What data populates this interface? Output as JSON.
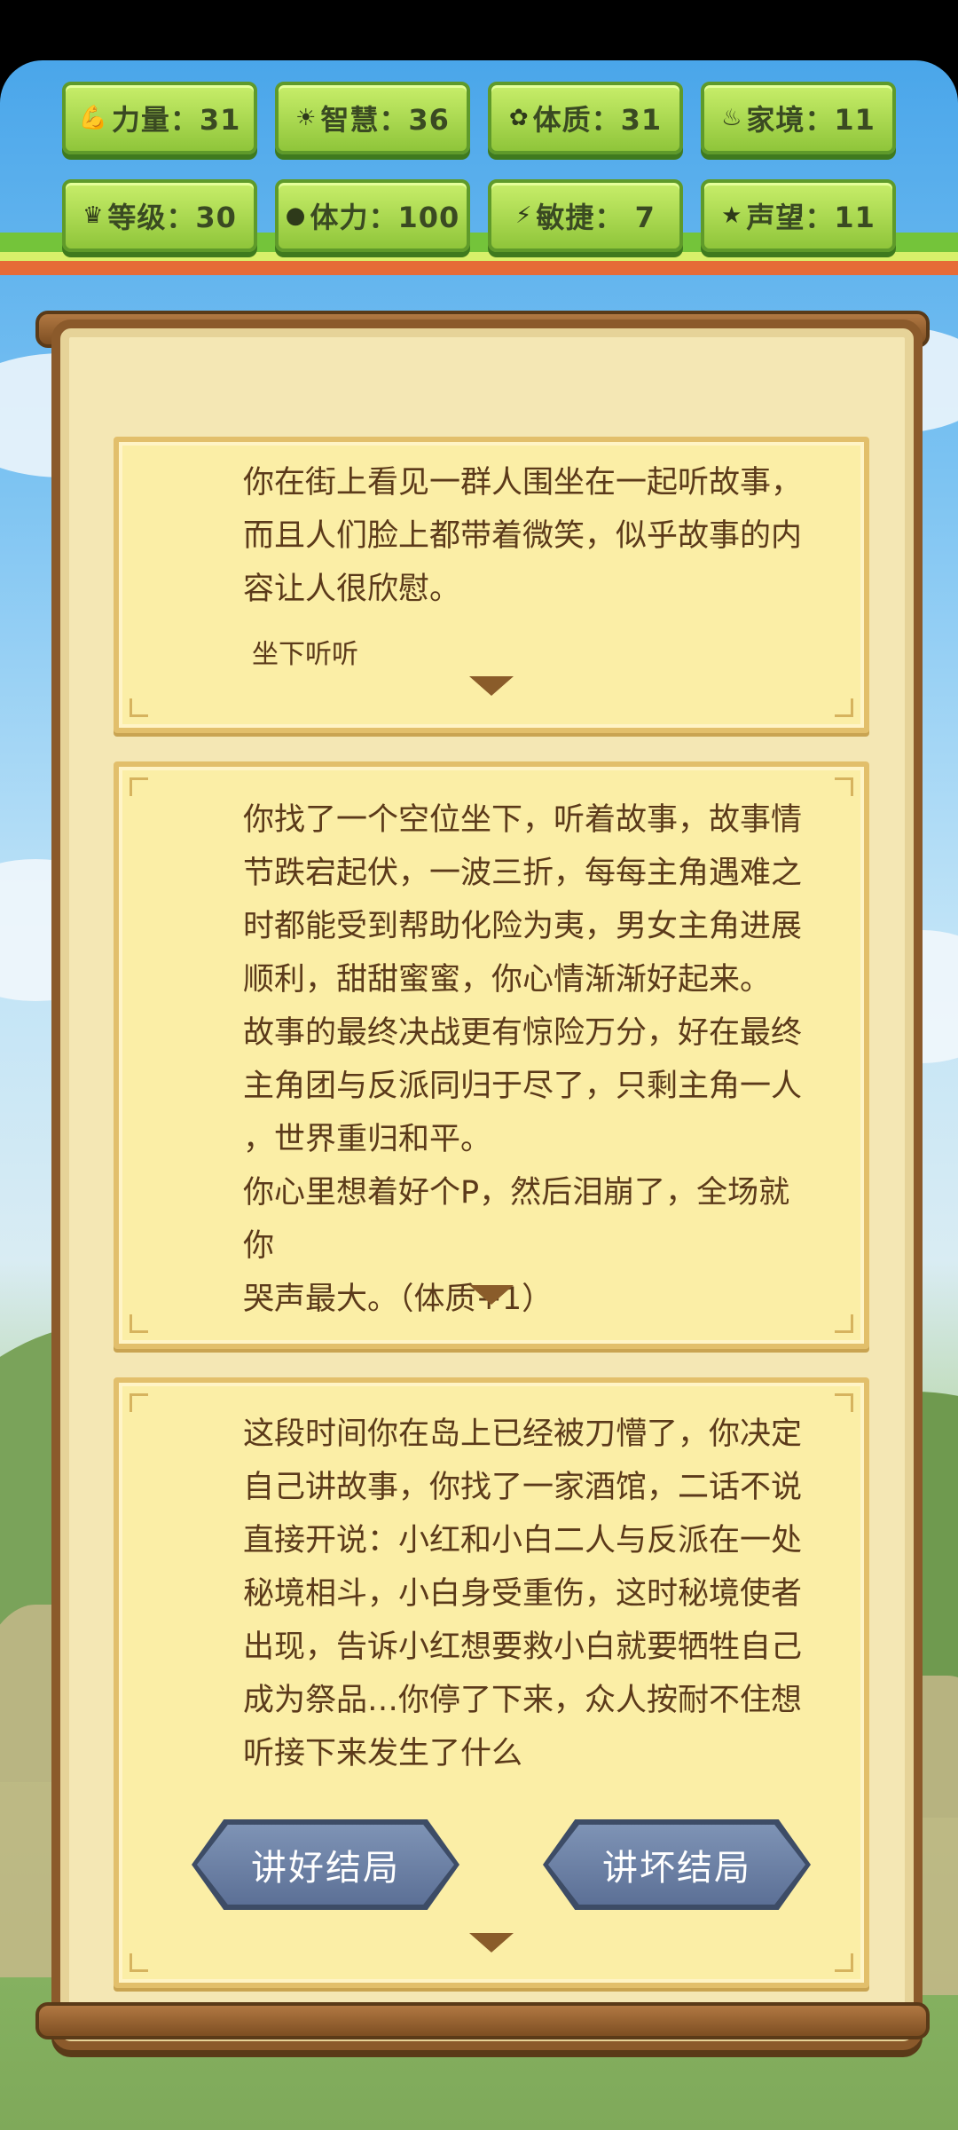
{
  "stats": [
    {
      "icon": "arm-icon",
      "glyph": "💪",
      "label": "力量：31"
    },
    {
      "icon": "sun-icon",
      "glyph": "☀",
      "label": "智慧：36"
    },
    {
      "icon": "constitution-icon",
      "glyph": "✿",
      "label": "体质：31"
    },
    {
      "icon": "family-icon",
      "glyph": "♨",
      "label": "家境：11"
    },
    {
      "icon": "crown-icon",
      "glyph": "♛",
      "label": "等级：30"
    },
    {
      "icon": "heart-icon",
      "glyph": "●",
      "label": "体力：100"
    },
    {
      "icon": "lightning-icon",
      "glyph": "⚡",
      "label": "敏捷：  7"
    },
    {
      "icon": "star-icon",
      "glyph": "★",
      "label": "声望：11"
    }
  ],
  "cards": [
    {
      "text": "你在街上看见一群人围坐在一起听故事，\n而且人们脸上都带着微笑，似乎故事的内\n容让人很欣慰。",
      "choice": "坐下听听"
    },
    {
      "text": "你找了一个空位坐下，听着故事，故事情\n节跌宕起伏，一波三折，每每主角遇难之\n时都能受到帮助化险为夷，男女主角进展\n顺利，甜甜蜜蜜，你心情渐渐好起来。\n故事的最终决战更有惊险万分，好在最终\n主角团与反派同归于尽了，只剩主角一人\n，世界重归和平。\n你心里想着好个P，然后泪崩了，全场就你\n哭声最大。（体质+1）"
    },
    {
      "text": "这段时间你在岛上已经被刀懵了，你决定\n自己讲故事，你找了一家酒馆，二话不说\n直接开说：小红和小白二人与反派在一处\n秘境相斗，小白身受重伤，这时秘境使者\n出现，告诉小红想要救小白就要牺牲自己\n成为祭品…你停了下来，众人按耐不住想\n听接下来发生了什么",
      "buttons": [
        "讲好结局",
        "讲坏结局"
      ]
    }
  ]
}
